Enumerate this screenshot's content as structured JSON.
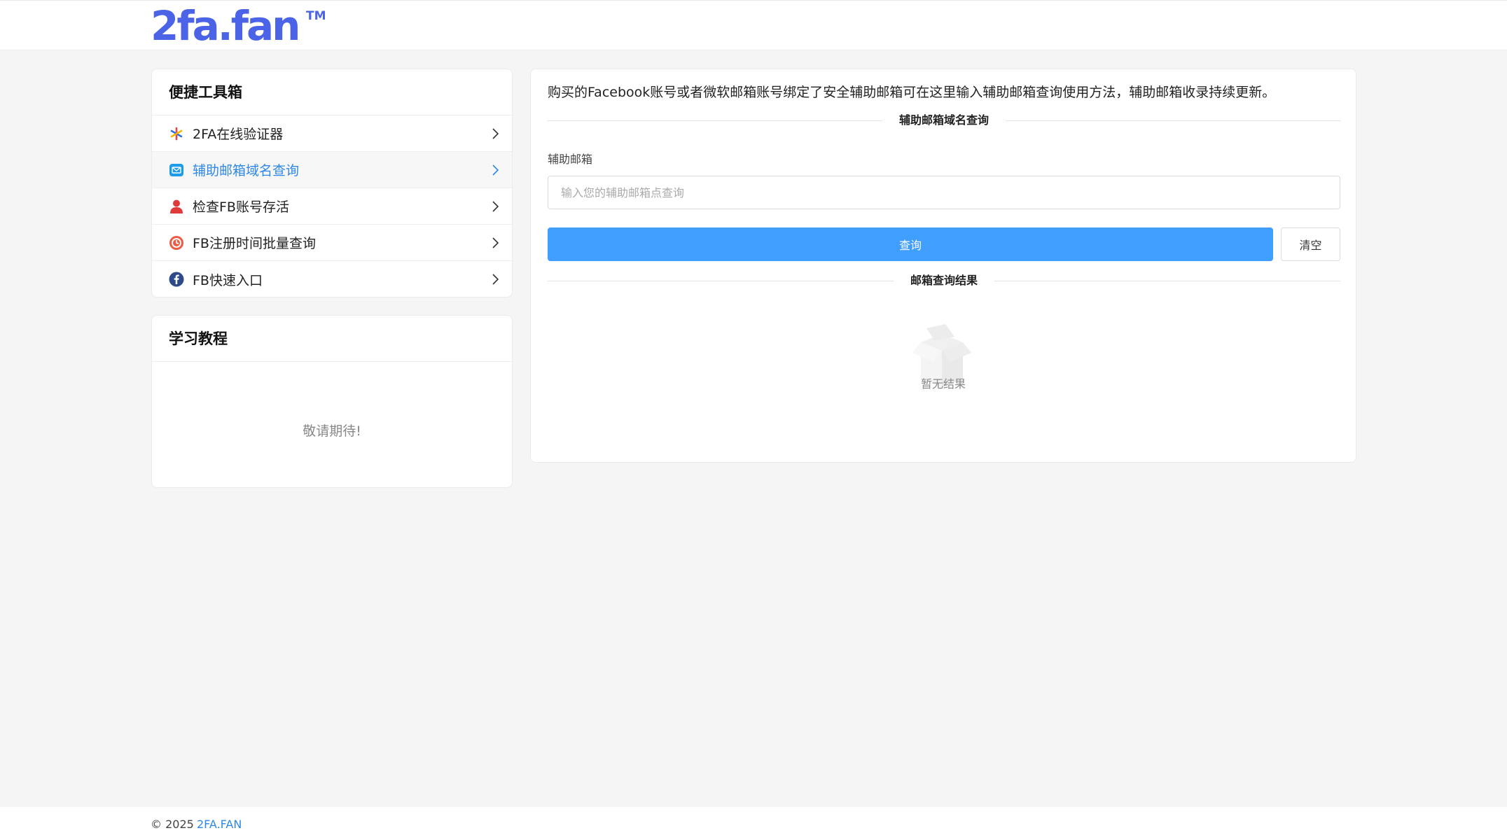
{
  "header": {
    "logo_text": "2fa.fan",
    "logo_tm": "TM"
  },
  "tools": {
    "title": "便捷工具箱",
    "items": [
      {
        "label": "2FA在线验证器",
        "icon": "asterisk-icon",
        "active": false
      },
      {
        "label": "辅助邮箱域名查询",
        "icon": "mail-icon",
        "active": true
      },
      {
        "label": "检查FB账号存活",
        "icon": "user-icon",
        "active": false
      },
      {
        "label": "FB注册时间批量查询",
        "icon": "clock-icon",
        "active": false
      },
      {
        "label": "FB快速入口",
        "icon": "facebook-icon",
        "active": false
      }
    ]
  },
  "tutorial": {
    "title": "学习教程",
    "placeholder": "敬请期待!"
  },
  "main": {
    "description": "购买的Facebook账号或者微软邮箱账号绑定了安全辅助邮箱可在这里输入辅助邮箱查询使用方法，辅助邮箱收录持续更新。",
    "section_title": "辅助邮箱域名查询",
    "field_label": "辅助邮箱",
    "input_placeholder": "输入您的辅助邮箱点查询",
    "input_value": "",
    "query_button": "查询",
    "clear_button": "清空",
    "result_title": "邮箱查询结果",
    "empty_text": "暂无结果"
  },
  "footer": {
    "copyright": "© 2025",
    "link_text": "2FA.FAN"
  },
  "colors": {
    "brand": "#4a63e7",
    "primary": "#409eff",
    "link": "#2f88e6"
  }
}
